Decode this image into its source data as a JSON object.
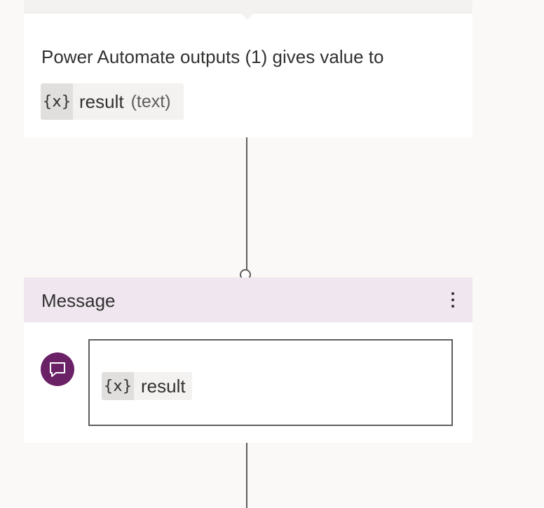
{
  "outputs_card": {
    "description": "Power Automate outputs (1) gives value to",
    "variable": {
      "icon_text": "{x}",
      "name": "result",
      "type": "(text)"
    }
  },
  "message_node": {
    "title": "Message",
    "more_icon": "more-vertical-icon",
    "avatar_icon": "chat-bubble-icon",
    "editor_variable": {
      "icon_text": "{x}",
      "name": "result"
    }
  },
  "colors": {
    "canvas_background": "#faf9f8",
    "message_header": "#efe6ef",
    "avatar": "#6b2166",
    "connector": "#605e5c"
  }
}
